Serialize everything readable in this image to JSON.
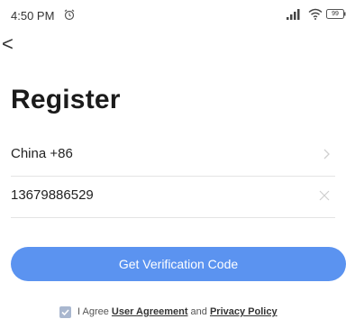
{
  "status_bar": {
    "time": "4:50 PM",
    "alarm_icon": "alarm-clock-icon",
    "signal_icon": "cellular-signal-icon",
    "wifi_icon": "wifi-icon",
    "battery_level": "99"
  },
  "nav": {
    "back_icon": "chevron-left-icon",
    "back_glyph": "<"
  },
  "title": "Register",
  "form": {
    "country": {
      "value": "China +86",
      "icon": "chevron-right-icon"
    },
    "phone": {
      "value": "13679886529",
      "icon": "clear-icon"
    }
  },
  "verify_button": {
    "label": "Get Verification Code",
    "color": "#5b93f0"
  },
  "agreement": {
    "checked": true,
    "prefix": "I Agree ",
    "user_agreement": "User Agreement",
    "conjunction": " and ",
    "privacy_policy": "Privacy Policy"
  }
}
